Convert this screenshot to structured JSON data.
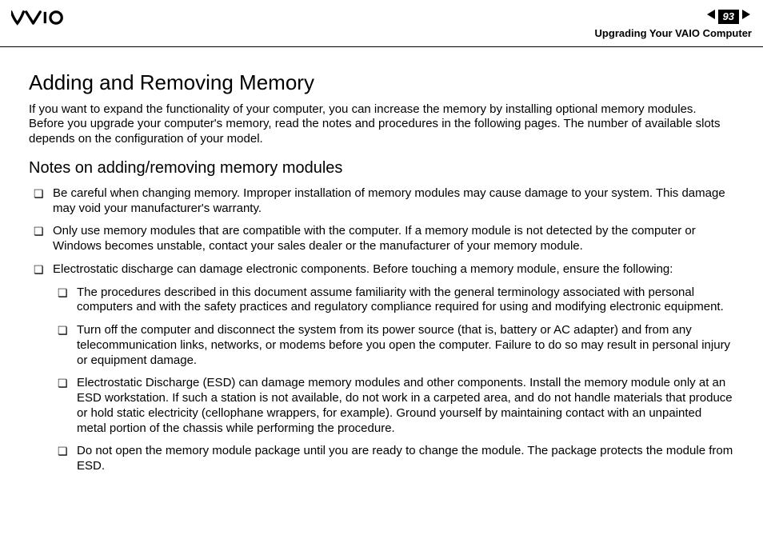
{
  "header": {
    "page_number": "93",
    "section": "Upgrading Your VAIO Computer"
  },
  "page": {
    "title": "Adding and Removing Memory",
    "intro": "If you want to expand the functionality of your computer, you can increase the memory by installing optional memory modules. Before you upgrade your computer's memory, read the notes and procedures in the following pages. The number of available slots depends on the configuration of your model.",
    "subheading": "Notes on adding/removing memory modules",
    "notes": [
      "Be careful when changing memory. Improper installation of memory modules may cause damage to your system. This damage may void your manufacturer's warranty.",
      "Only use memory modules that are compatible with the computer. If a memory module is not detected by the computer or Windows becomes unstable, contact your sales dealer or the manufacturer of your memory module.",
      "Electrostatic discharge can damage electronic components. Before touching a memory module, ensure the following:"
    ],
    "subnotes": [
      "The procedures described in this document assume familiarity with the general terminology associated with personal computers and with the safety practices and regulatory compliance required for using and modifying electronic equipment.",
      "Turn off the computer and disconnect the system from its power source (that is, battery or AC adapter) and from any telecommunication links, networks, or modems before you open the computer. Failure to do so may result in personal injury or equipment damage.",
      "Electrostatic Discharge (ESD) can damage memory modules and other components. Install the memory module only at an ESD workstation. If such a station is not available, do not work in a carpeted area, and do not handle materials that produce or hold static electricity (cellophane wrappers, for example). Ground yourself by maintaining contact with an unpainted metal portion of the chassis while performing the procedure.",
      "Do not open the memory module package until you are ready to change the module. The package protects the module from ESD."
    ]
  }
}
